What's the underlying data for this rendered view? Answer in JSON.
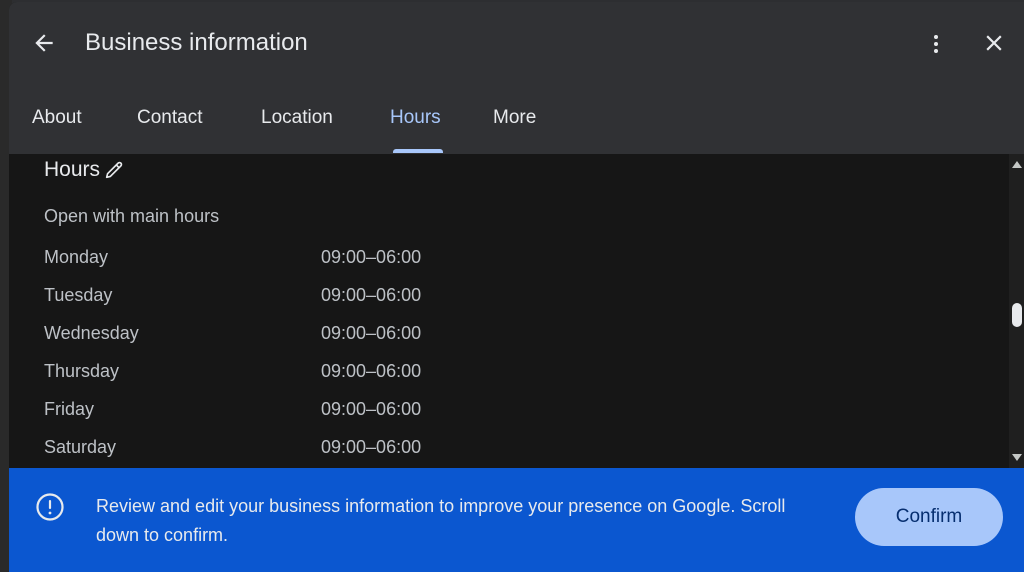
{
  "dialog": {
    "title": "Business information"
  },
  "tabs": [
    {
      "label": "About",
      "active": false
    },
    {
      "label": "Contact",
      "active": false
    },
    {
      "label": "Location",
      "active": false
    },
    {
      "label": "Hours",
      "active": true
    },
    {
      "label": "More",
      "active": false
    }
  ],
  "hours": {
    "section_title": "Hours",
    "status": "Open with main hours",
    "schedule": [
      {
        "day": "Monday",
        "time": "09:00–06:00"
      },
      {
        "day": "Tuesday",
        "time": "09:00–06:00"
      },
      {
        "day": "Wednesday",
        "time": "09:00–06:00"
      },
      {
        "day": "Thursday",
        "time": "09:00–06:00"
      },
      {
        "day": "Friday",
        "time": "09:00–06:00"
      },
      {
        "day": "Saturday",
        "time": "09:00–06:00"
      }
    ]
  },
  "banner": {
    "message": "Review and edit your business information to improve your presence on Google. Scroll down to confirm.",
    "confirm_label": "Confirm",
    "icon": "alert-circle-icon"
  },
  "icons": {
    "back": "arrow-left-icon",
    "more": "more-vert-icon",
    "close": "close-icon",
    "edit": "pencil-icon"
  },
  "colors": {
    "accent": "#a8c7fa",
    "banner": "#0b57d0",
    "header": "#303134",
    "content": "#161616"
  }
}
